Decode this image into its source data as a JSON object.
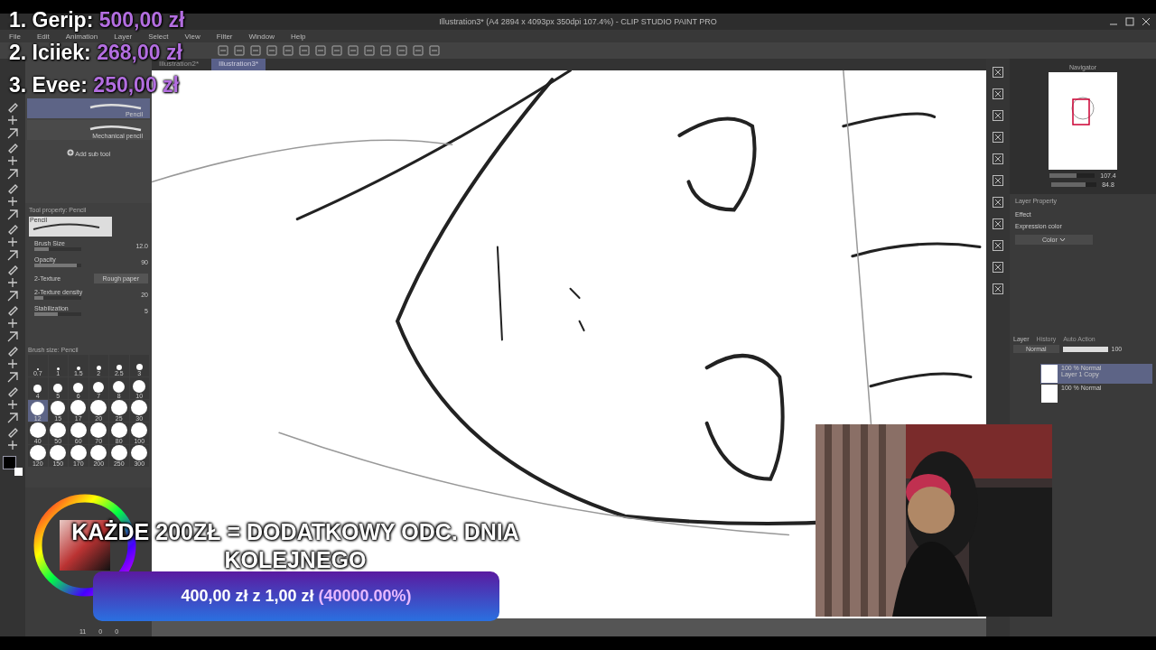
{
  "window": {
    "title": "Illustration3* (A4 2894 x 4093px 350dpi 107.4%)  - CLIP STUDIO PAINT PRO"
  },
  "menu": [
    "File",
    "Edit",
    "Animation",
    "Layer",
    "Select",
    "View",
    "Filter",
    "Window",
    "Help"
  ],
  "doc_tabs": [
    {
      "label": "Illustration2*",
      "selected": false
    },
    {
      "label": "Illustration3*",
      "selected": true
    }
  ],
  "sub_tool": {
    "items": [
      {
        "label": "Pencil",
        "selected": true
      },
      {
        "label": "Mechanical pencil",
        "selected": false
      }
    ],
    "add": "Add sub tool"
  },
  "tool_property": {
    "title": "Tool property: Pencil",
    "preview": "Pencil",
    "props": [
      {
        "kind": "slider",
        "label": "Brush Size",
        "value": "12.0",
        "level": 0.3
      },
      {
        "kind": "slider",
        "label": "Opacity",
        "value": "90",
        "level": 0.9
      },
      {
        "kind": "button",
        "label": "2-Texture",
        "value": "Rough paper"
      },
      {
        "kind": "slider",
        "label": "2-Texture density",
        "value": "20",
        "level": 0.2
      },
      {
        "kind": "slider",
        "label": "Stabilization",
        "value": "5",
        "level": 0.5
      }
    ]
  },
  "brush_size": {
    "title": "Brush size: Pencil",
    "sizes": [
      {
        "label": "0.7",
        "selected": false
      },
      {
        "label": "1",
        "selected": false
      },
      {
        "label": "1.5",
        "selected": false
      },
      {
        "label": "2",
        "selected": false
      },
      {
        "label": "2.5",
        "selected": false
      },
      {
        "label": "3",
        "selected": false
      },
      {
        "label": "4",
        "selected": false
      },
      {
        "label": "5",
        "selected": false
      },
      {
        "label": "6",
        "selected": false
      },
      {
        "label": "7",
        "selected": false
      },
      {
        "label": "8",
        "selected": false
      },
      {
        "label": "10",
        "selected": false
      },
      {
        "label": "12",
        "selected": true
      },
      {
        "label": "15",
        "selected": false
      },
      {
        "label": "17",
        "selected": false
      },
      {
        "label": "20",
        "selected": false
      },
      {
        "label": "25",
        "selected": false
      },
      {
        "label": "30",
        "selected": false
      },
      {
        "label": "40",
        "selected": false
      },
      {
        "label": "50",
        "selected": false
      },
      {
        "label": "60",
        "selected": false
      },
      {
        "label": "70",
        "selected": false
      },
      {
        "label": "80",
        "selected": false
      },
      {
        "label": "100",
        "selected": false
      },
      {
        "label": "120",
        "selected": false
      },
      {
        "label": "150",
        "selected": false
      },
      {
        "label": "170",
        "selected": false
      },
      {
        "label": "200",
        "selected": false
      },
      {
        "label": "250",
        "selected": false
      },
      {
        "label": "300",
        "selected": false
      }
    ]
  },
  "color_status": [
    "11",
    "0",
    "0"
  ],
  "navigator": {
    "title": "Navigator",
    "zoom": {
      "value": "107.4",
      "level": 0.6
    },
    "angle": {
      "value": "84.8",
      "level": 0.75
    }
  },
  "layer_property": {
    "title": "Layer Property",
    "effect": "Effect",
    "expression": "Expression color",
    "expression_value": "Color"
  },
  "layer_panel": {
    "tabs": [
      {
        "label": "Layer",
        "selected": true
      },
      {
        "label": "History",
        "selected": false
      },
      {
        "label": "Auto Action",
        "selected": false
      }
    ],
    "blend": "Normal",
    "opacity": {
      "value": "100",
      "level": 1
    },
    "layers": [
      {
        "mode": "100 % Normal",
        "name": "Layer 1 Copy",
        "selected": true
      },
      {
        "mode": "100 % Normal",
        "selected": false
      }
    ]
  },
  "leaderboard": [
    {
      "rank": "1.",
      "name": "Gerip:",
      "amount": "500,00 zł"
    },
    {
      "rank": "2.",
      "name": "Iciiek:",
      "amount": "268,00 zł"
    },
    {
      "rank": "3.",
      "name": "Evee:",
      "amount": "250,00 zł"
    }
  ],
  "goal": {
    "text": "KAŻDE 200ZŁ = DODATKOWY ODC. DNIA KOLEJNEGO",
    "current": "400,00 zł",
    "separator": "z",
    "target": "1,00 zł",
    "percent": "(40000.00%)"
  }
}
